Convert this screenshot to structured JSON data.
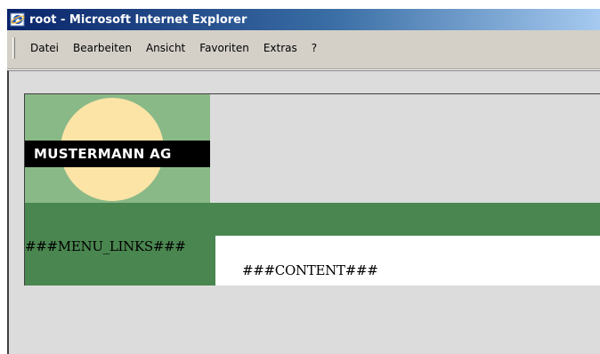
{
  "window": {
    "title": "root - Microsoft Internet Explorer"
  },
  "menubar": {
    "items": [
      {
        "label": "Datei"
      },
      {
        "label": "Bearbeiten"
      },
      {
        "label": "Ansicht"
      },
      {
        "label": "Favoriten"
      },
      {
        "label": "Extras"
      },
      {
        "label": "?"
      }
    ]
  },
  "page": {
    "logo_text": "MUSTERMANN AG",
    "menu_placeholder": "###MENU_LINKS###",
    "content_placeholder": "###CONTENT###"
  },
  "colors": {
    "logo_background": "#8ab988",
    "logo_sun": "#fce4a6",
    "green_bar": "#4a8650",
    "viewport_background": "#dcdcdc"
  },
  "icons": {
    "title_icon": "ie-browser-icon"
  }
}
